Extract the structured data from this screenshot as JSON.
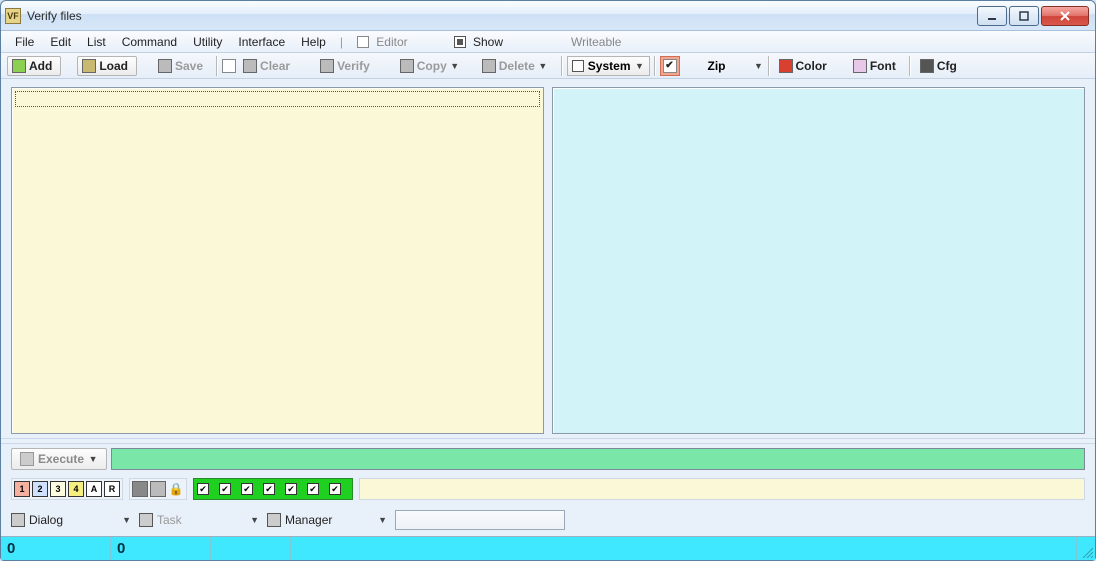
{
  "title": "Verify files",
  "menu": {
    "file": "File",
    "edit": "Edit",
    "list": "List",
    "command": "Command",
    "utility": "Utility",
    "interface": "Interface",
    "help": "Help",
    "editor": "Editor",
    "show": "Show",
    "writeable": "Writeable"
  },
  "toolbar": {
    "add": "Add",
    "load": "Load",
    "save": "Save",
    "clear": "Clear",
    "verify": "Verify",
    "copy": "Copy",
    "delete": "Delete",
    "system": "System",
    "zip": "Zip",
    "color": "Color",
    "font": "Font",
    "cfg": "Cfg"
  },
  "execute": {
    "label": "Execute"
  },
  "flags": {
    "n1": "1",
    "n2": "2",
    "n3": "3",
    "n4": "4",
    "a": "A",
    "r": "R"
  },
  "dropdowns": {
    "dialog": "Dialog",
    "task": "Task",
    "manager": "Manager"
  },
  "status": {
    "v0": "0",
    "v1": "0"
  }
}
